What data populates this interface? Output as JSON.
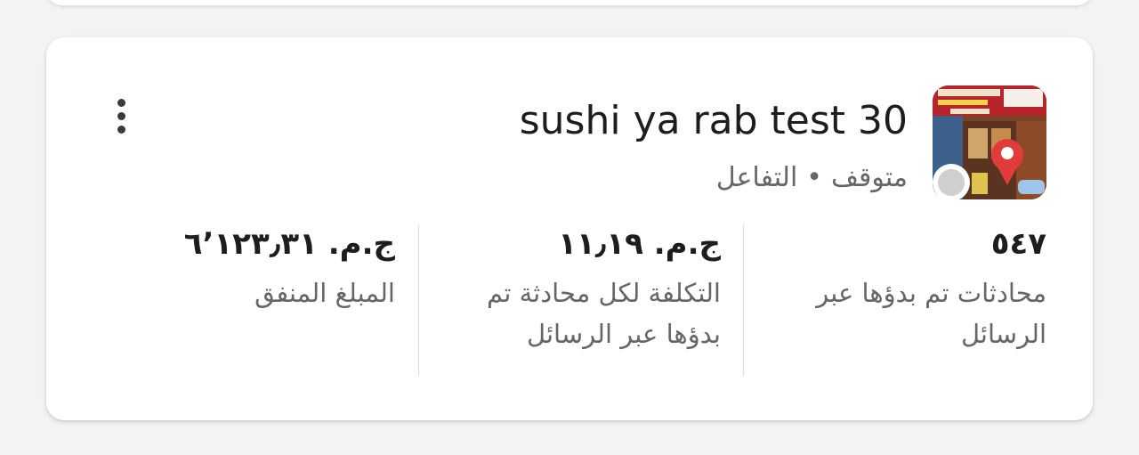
{
  "campaign": {
    "title": "sushi ya rab test 30",
    "status": "متوقف",
    "separator": "•",
    "objective": "التفاعل",
    "status_color": "#cfcfcf"
  },
  "metrics": [
    {
      "value": "٥٤٧",
      "label": "محادثات تم بدؤها عبر الرسائل"
    },
    {
      "value": "ج.م. ١١٫١٩",
      "label": "التكلفة لكل محادثة تم بدؤها عبر الرسائل"
    },
    {
      "value": "ج.م. ٦٬١٢٣٫٣١",
      "label": "المبلغ المنفق"
    }
  ],
  "icons": {
    "thumbnail": "campaign-thumbnail-image",
    "menu": "more-vertical-icon",
    "status": "status-dot-icon"
  }
}
